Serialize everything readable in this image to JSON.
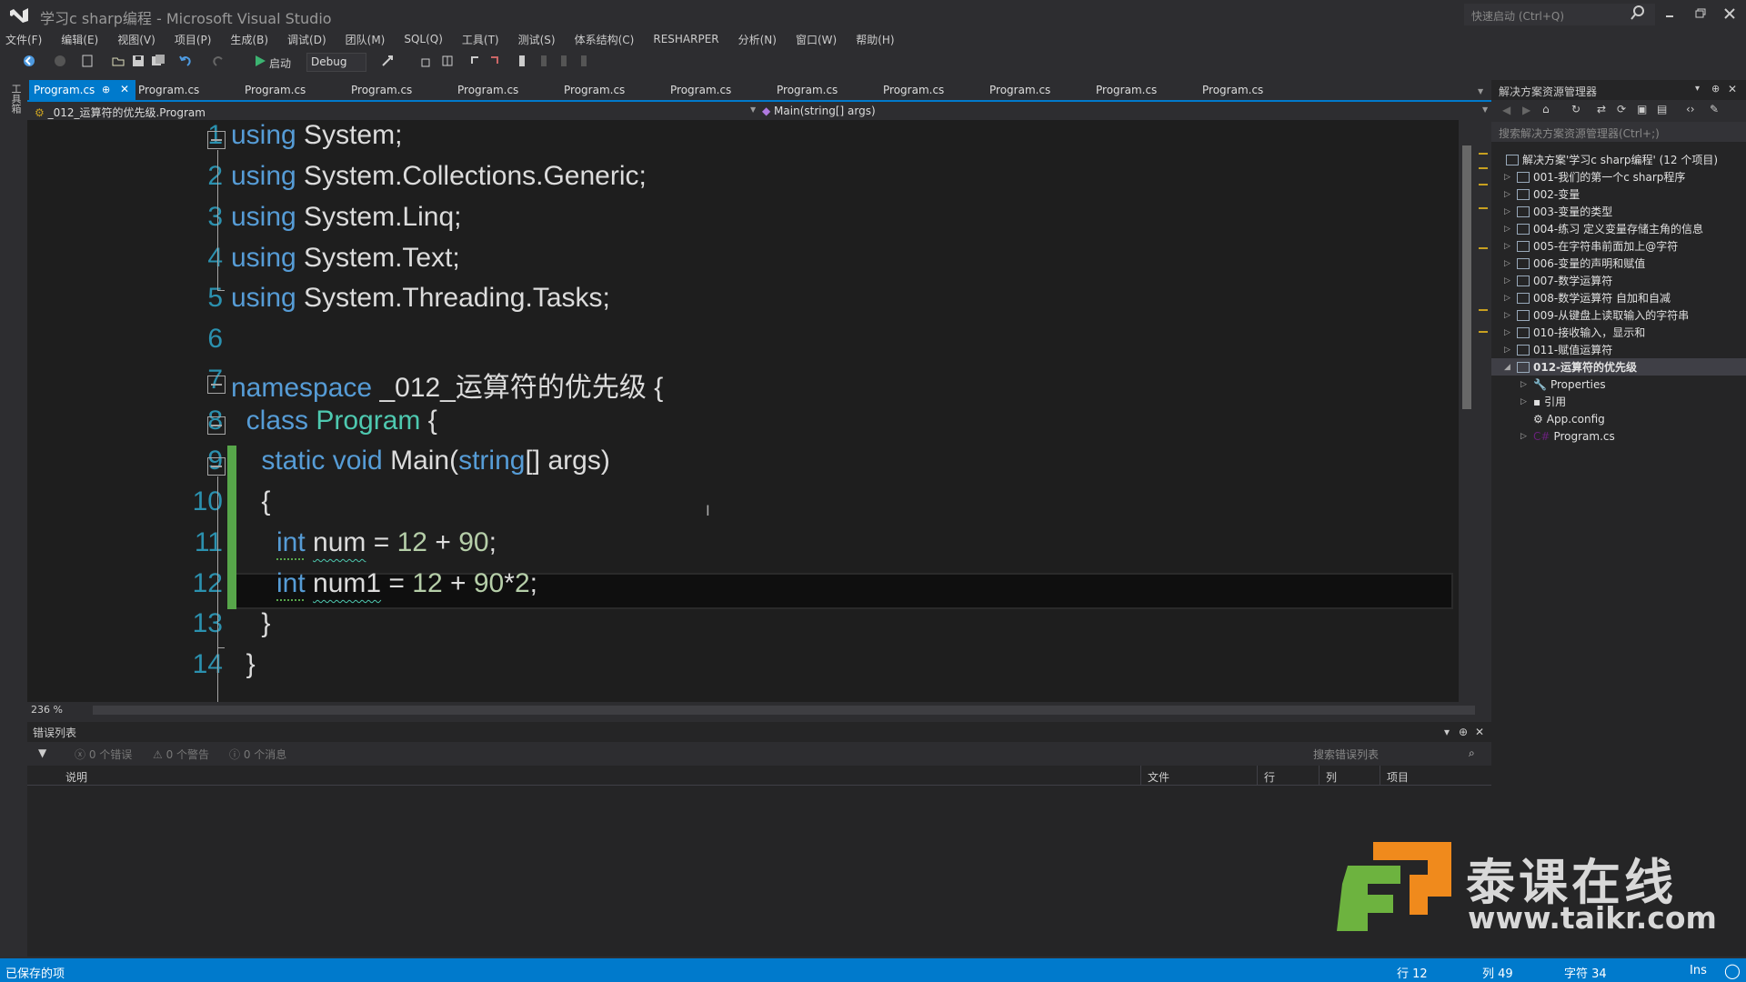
{
  "window": {
    "title": "学习c sharp编程 - Microsoft Visual Studio",
    "quick_launch_placeholder": "快速启动 (Ctrl+Q)"
  },
  "menu": [
    "文件(F)",
    "编辑(E)",
    "视图(V)",
    "项目(P)",
    "生成(B)",
    "调试(D)",
    "团队(M)",
    "SQL(Q)",
    "工具(T)",
    "测试(S)",
    "体系结构(C)",
    "RESHARPER",
    "分析(N)",
    "窗口(W)",
    "帮助(H)"
  ],
  "toolbar": {
    "start_label": "启动",
    "config_value": "Debug"
  },
  "toolbox_label": "工具箱",
  "tabs": {
    "active": "Program.cs",
    "others": [
      "Program.cs",
      "Program.cs",
      "Program.cs",
      "Program.cs",
      "Program.cs",
      "Program.cs",
      "Program.cs",
      "Program.cs",
      "Program.cs",
      "Program.cs",
      "Program.cs"
    ]
  },
  "nav": {
    "type": "_012_运算符的优先级.Program",
    "member": "Main(string[] args)"
  },
  "editor": {
    "line_numbers": [
      "1",
      "2",
      "3",
      "4",
      "5",
      "6",
      "7",
      "8",
      "9",
      "10",
      "11",
      "12",
      "13",
      "14"
    ],
    "zoom": "236 %",
    "lines": {
      "l1": {
        "kw": "using",
        "rest": " System;"
      },
      "l2": {
        "kw": "using",
        "rest": " System.Collections.Generic;"
      },
      "l3": {
        "kw": "using",
        "rest": " System.Linq;"
      },
      "l4": {
        "kw": "using",
        "rest": " System.Text;"
      },
      "l5": {
        "kw": "using",
        "rest": " System.Threading.Tasks;"
      },
      "l7": {
        "kw": "namespace",
        "rest": " _012_运算符的优先级 {"
      },
      "l8": {
        "indent": "  ",
        "kw": "class",
        "type": "Program",
        "rest": " {"
      },
      "l9": {
        "indent": "    ",
        "kw": "static void",
        "name": "Main(",
        "type": "string",
        "rest": "[] args)"
      },
      "l10": {
        "text": "    {"
      },
      "l11": {
        "indent": "      ",
        "kw": "int",
        "var": "num",
        "op": " = ",
        "n1": "12",
        "plus": " + ",
        "n2": "90",
        "end": ";"
      },
      "l12": {
        "indent": "      ",
        "kw": "int",
        "var": "num1",
        "op": " = ",
        "n1": "12",
        "plus": " + ",
        "n2": "90",
        "star": "*",
        "n3": "2",
        "end": ";"
      },
      "l13": {
        "text": "    }"
      },
      "l14": {
        "text": "  }"
      }
    }
  },
  "error_list": {
    "title": "错误列表",
    "errors": "0 个错误",
    "warnings": "0 个警告",
    "messages": "0 个消息",
    "search_placeholder": "搜索错误列表",
    "columns": [
      "说明",
      "文件",
      "行",
      "列",
      "项目"
    ]
  },
  "solution_explorer": {
    "title": "解决方案资源管理器",
    "search_placeholder": "搜索解决方案资源管理器(Ctrl+;)",
    "solution": "解决方案'学习c sharp编程' (12 个项目)",
    "projects": [
      "001-我们的第一个c sharp程序",
      "002-变量",
      "003-变量的类型",
      "004-练习 定义变量存储主角的信息",
      "005-在字符串前面加上@字符",
      "006-变量的声明和赋值",
      "007-数学运算符",
      "008-数学运算符 自加和自减",
      "009-从键盘上读取输入的字符串",
      "010-接收输入，显示和",
      "011-赋值运算符",
      "012-运算符的优先级"
    ],
    "children": [
      "Properties",
      "引用",
      "App.config",
      "Program.cs"
    ]
  },
  "watermark": {
    "brand": "泰课在线",
    "url": "www.taikr.com"
  },
  "status": {
    "message": "已保存的项",
    "line": "行 12",
    "col": "列 49",
    "char": "字符 34",
    "mode": "Ins"
  },
  "colors": {
    "accent": "#007acc",
    "keyword": "#569cd6",
    "type": "#4ec9b0",
    "number": "#b5cea8",
    "line_number": "#2b91af"
  }
}
